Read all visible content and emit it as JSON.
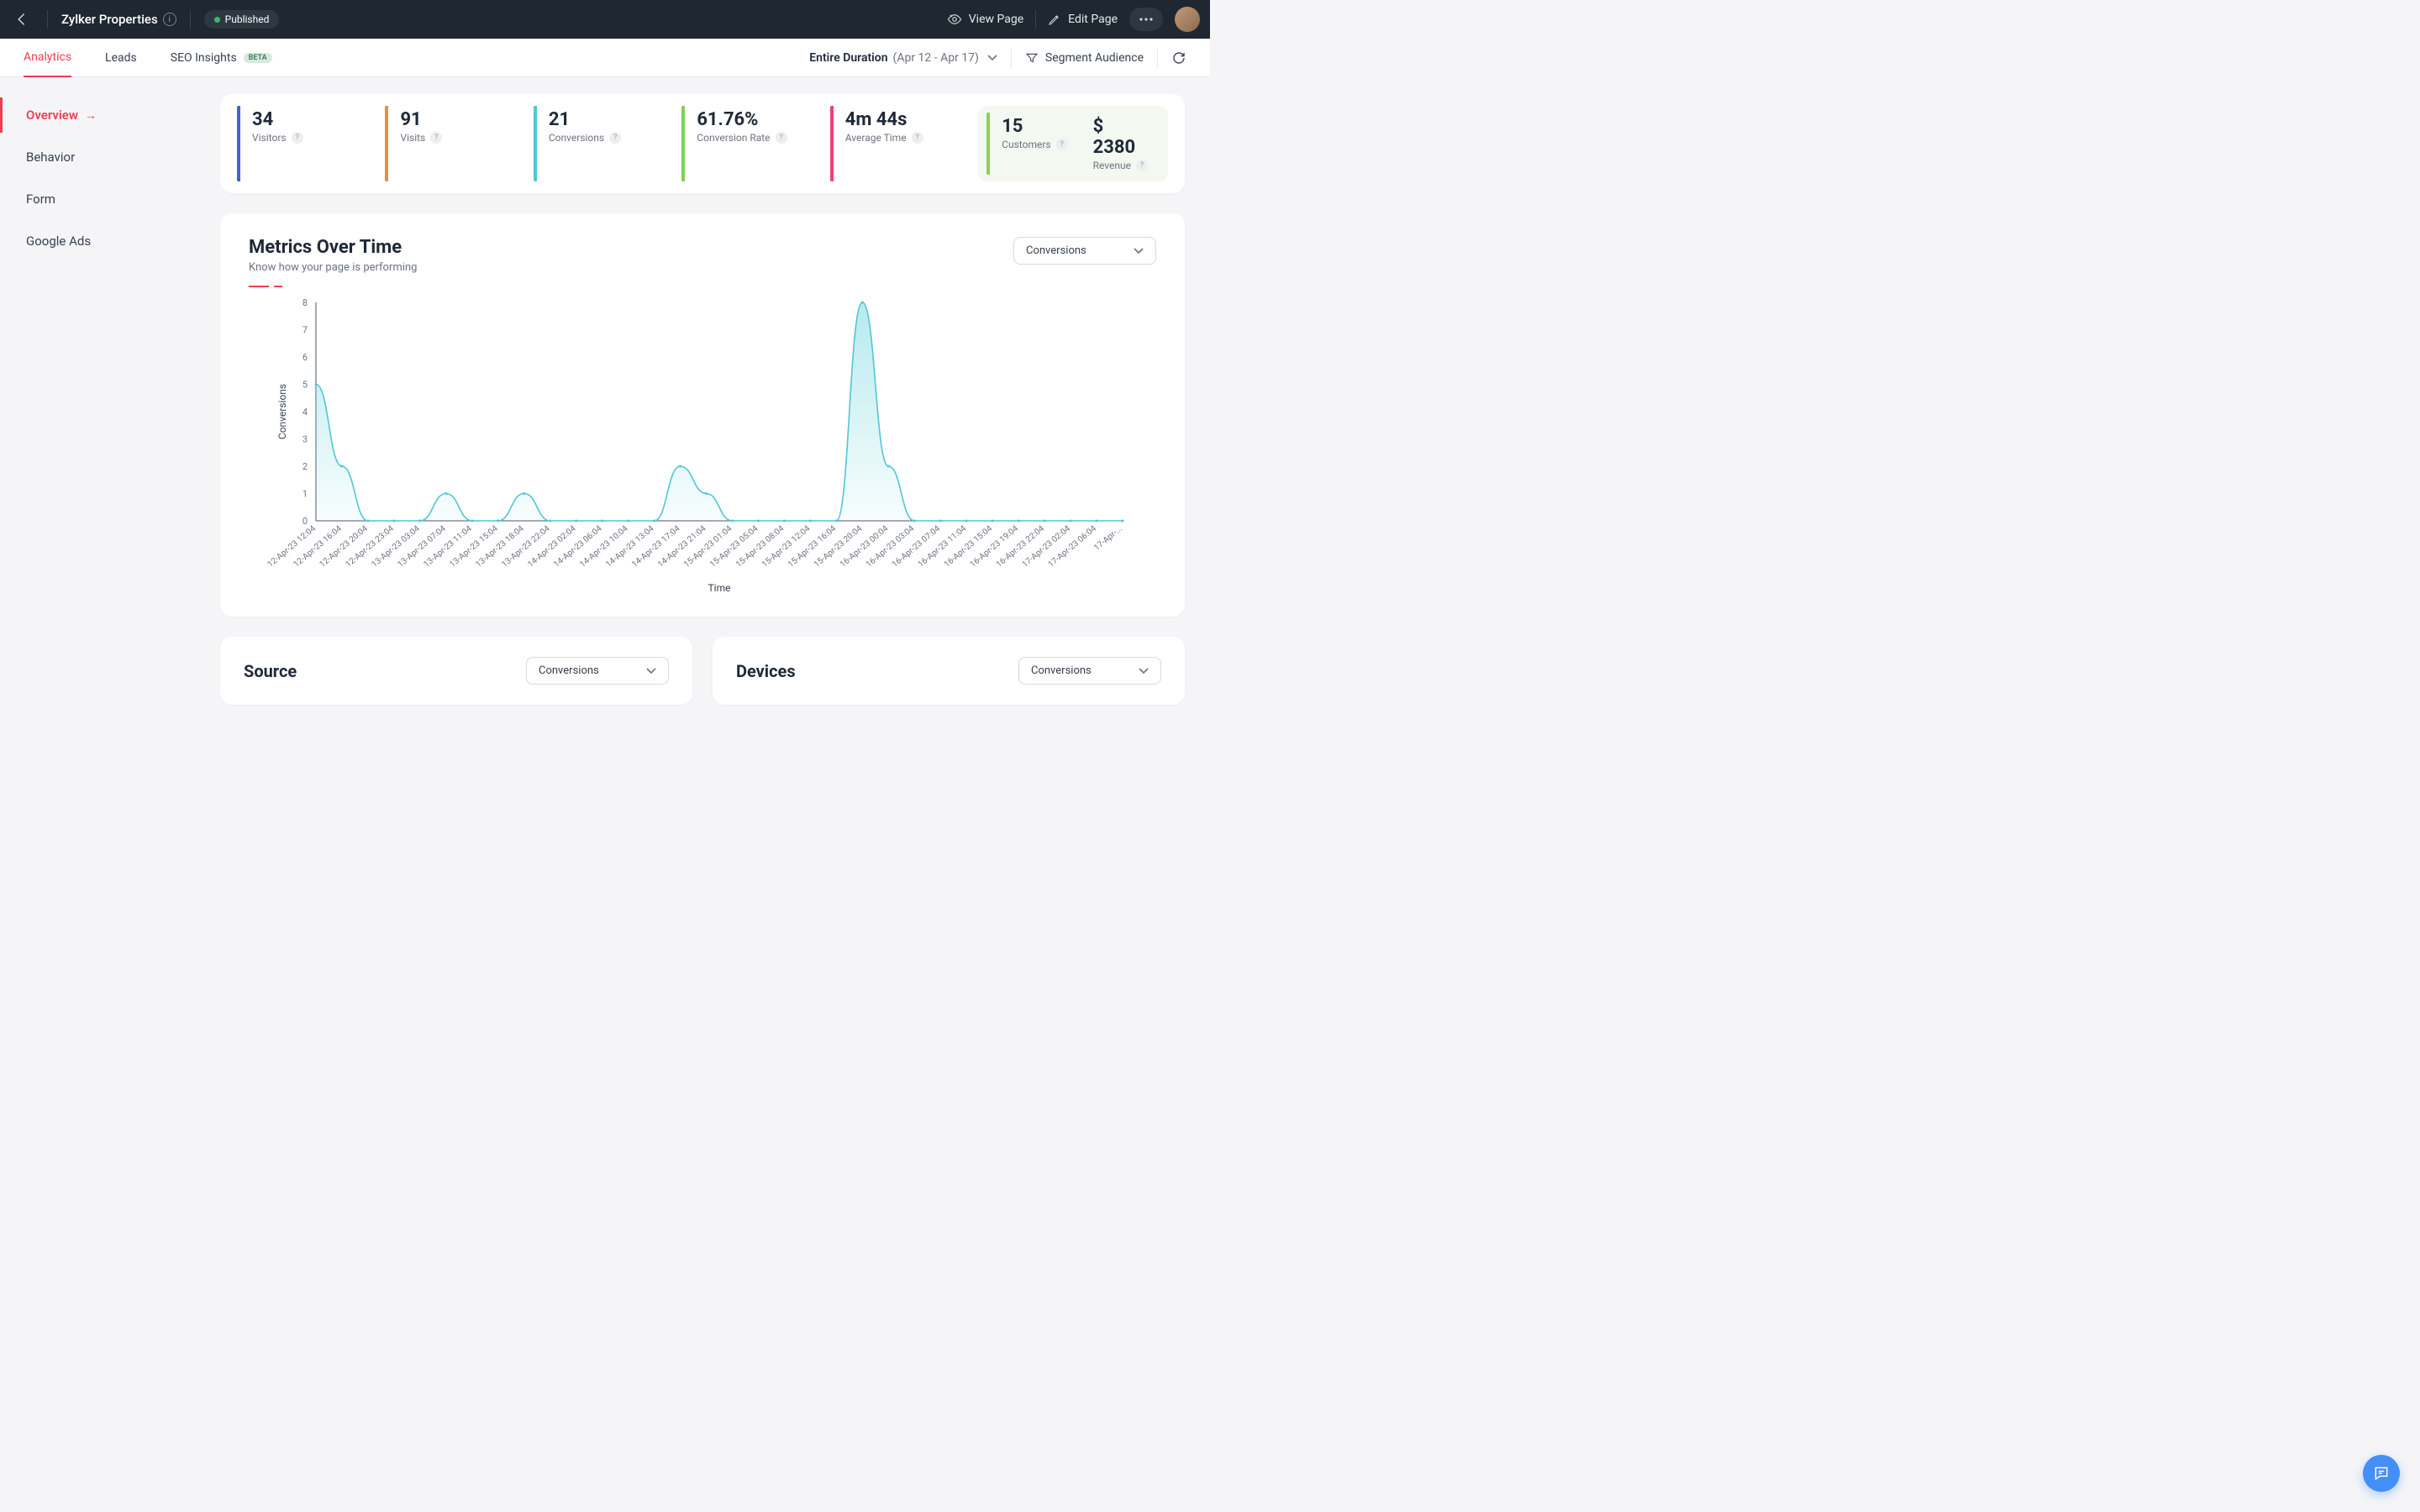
{
  "topbar": {
    "page_name": "Zylker Properties",
    "status": "Published",
    "view_page": "View Page",
    "edit_page": "Edit Page"
  },
  "tabs": {
    "analytics": "Analytics",
    "leads": "Leads",
    "seo": "SEO Insights",
    "beta": "BETA",
    "duration_label": "Entire Duration",
    "duration_range": "(Apr 12 - Apr 17)",
    "segment": "Segment Audience"
  },
  "sidebar": {
    "overview": "Overview",
    "behavior": "Behavior",
    "form": "Form",
    "google_ads": "Google Ads"
  },
  "metrics": {
    "visitors_val": "34",
    "visitors_label": "Visitors",
    "visits_val": "91",
    "visits_label": "Visits",
    "conversions_val": "21",
    "conversions_label": "Conversions",
    "rate_val": "61.76%",
    "rate_label": "Conversion Rate",
    "avg_time_val": "4m 44s",
    "avg_time_label": "Average Time",
    "customers_val": "15",
    "customers_label": "Customers",
    "revenue_val": "$ 2380",
    "revenue_label": "Revenue"
  },
  "chart": {
    "title": "Metrics Over Time",
    "subtitle": "Know how your page is performing",
    "dropdown": "Conversions",
    "xlabel": "Time",
    "ylabel_vertical": "Conversions"
  },
  "bottom": {
    "source_title": "Source",
    "source_dropdown": "Conversions",
    "devices_title": "Devices",
    "devices_dropdown": "Conversions"
  },
  "chart_data": {
    "type": "area",
    "title": "Metrics Over Time",
    "xlabel": "Time",
    "ylabel": "Conversions",
    "ylim": [
      0,
      8
    ],
    "categories": [
      "12-Apr-23 12:04",
      "12-Apr-23 16:04",
      "12-Apr-23 20:04",
      "12-Apr-23 23:04",
      "13-Apr-23 03:04",
      "13-Apr-23 07:04",
      "13-Apr-23 11:04",
      "13-Apr-23 15:04",
      "13-Apr-23 18:04",
      "13-Apr-23 22:04",
      "14-Apr-23 02:04",
      "14-Apr-23 06:04",
      "14-Apr-23 10:04",
      "14-Apr-23 13:04",
      "14-Apr-23 17:04",
      "14-Apr-23 21:04",
      "15-Apr-23 01:04",
      "15-Apr-23 05:04",
      "15-Apr-23 08:04",
      "15-Apr-23 12:04",
      "15-Apr-23 16:04",
      "15-Apr-23 20:04",
      "16-Apr-23 00:04",
      "16-Apr-23 03:04",
      "16-Apr-23 07:04",
      "16-Apr-23 11:04",
      "16-Apr-23 15:04",
      "16-Apr-23 19:04",
      "16-Apr-23 22:04",
      "17-Apr-23 02:04",
      "17-Apr-23 06:04",
      "17-Apr-..."
    ],
    "values": [
      5,
      2,
      0,
      0,
      0,
      1,
      0,
      0,
      1,
      0,
      0,
      0,
      0,
      0,
      2,
      1,
      0,
      0,
      0,
      0,
      0,
      8,
      2,
      0,
      0,
      0,
      0,
      0,
      0,
      0,
      0,
      0
    ],
    "y_ticks": [
      0,
      1,
      2,
      3,
      4,
      5,
      6,
      7,
      8
    ]
  }
}
